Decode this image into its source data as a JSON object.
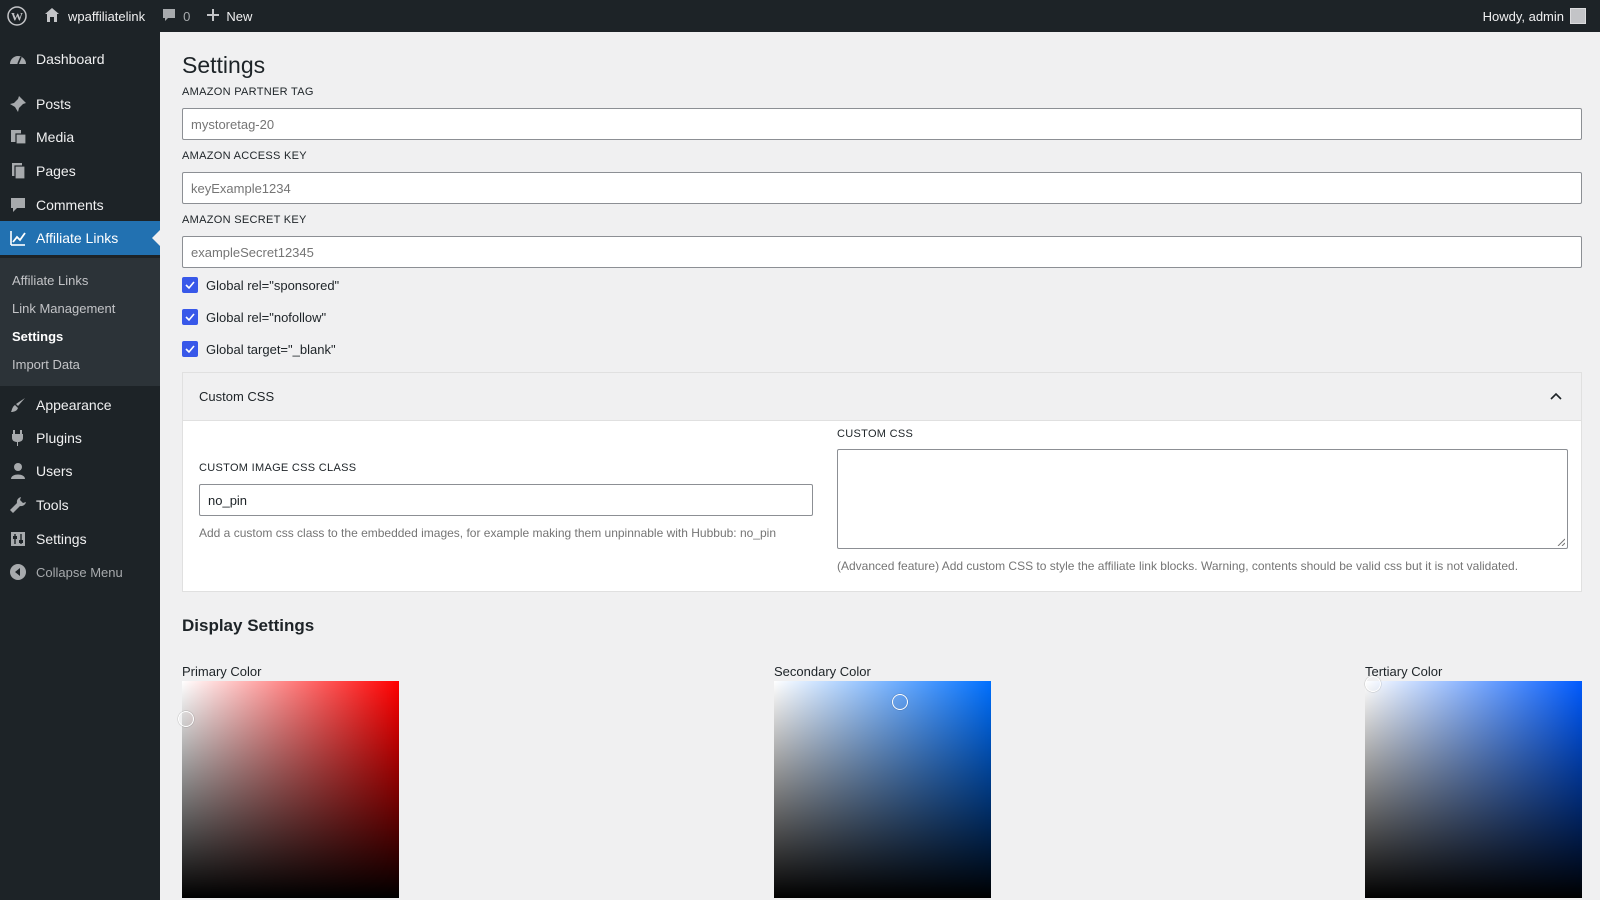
{
  "adminbar": {
    "site_name": "wpaffiliatelink",
    "comments_count": "0",
    "new_label": "New",
    "greeting": "Howdy, admin"
  },
  "sidebar": {
    "items": [
      {
        "label": "Dashboard",
        "icon": "dashboard-icon"
      },
      {
        "label": "Posts",
        "icon": "pushpin-icon"
      },
      {
        "label": "Media",
        "icon": "media-icon"
      },
      {
        "label": "Pages",
        "icon": "pages-icon"
      },
      {
        "label": "Comments",
        "icon": "comment-icon"
      },
      {
        "label": "Affiliate Links",
        "icon": "chart-line-icon"
      },
      {
        "label": "Appearance",
        "icon": "paintbrush-icon"
      },
      {
        "label": "Plugins",
        "icon": "plugin-icon"
      },
      {
        "label": "Users",
        "icon": "user-icon"
      },
      {
        "label": "Tools",
        "icon": "wrench-icon"
      },
      {
        "label": "Settings",
        "icon": "settings-icon"
      }
    ],
    "submenu": [
      "Affiliate Links",
      "Link Management",
      "Settings",
      "Import Data"
    ],
    "collapse_label": "Collapse Menu"
  },
  "page": {
    "title": "Settings",
    "fields": {
      "partner_tag": {
        "label": "AMAZON PARTNER TAG",
        "value": "mystoretag-20"
      },
      "access_key": {
        "label": "AMAZON ACCESS KEY",
        "value": "keyExample1234"
      },
      "secret_key": {
        "label": "AMAZON SECRET KEY",
        "value": "exampleSecret12345"
      }
    },
    "checkboxes": [
      "Global rel=\"sponsored\"",
      "Global rel=\"nofollow\"",
      "Global target=\"_blank\""
    ],
    "custom_css_panel": {
      "title": "Custom CSS",
      "image_class_label": "CUSTOM IMAGE CSS CLASS",
      "image_class_value": "no_pin",
      "image_class_help": "Add a custom css class to the embedded images, for example making them unpinnable with Hubbub: no_pin",
      "css_label": "CUSTOM CSS",
      "css_help": "(Advanced feature) Add custom CSS to style the affiliate link blocks. Warning, contents should be valid css but it is not validated."
    },
    "display_settings": {
      "title": "Display Settings",
      "pickers": [
        {
          "label": "Primary Color",
          "hue": "#ff0000"
        },
        {
          "label": "Secondary Color",
          "hue": "#0070ff"
        },
        {
          "label": "Tertiary Color",
          "hue": "#005bff"
        }
      ]
    }
  },
  "colors": {
    "admin_dark": "#1d2327",
    "accent": "#2271b1",
    "checkbox": "#3858e9"
  }
}
